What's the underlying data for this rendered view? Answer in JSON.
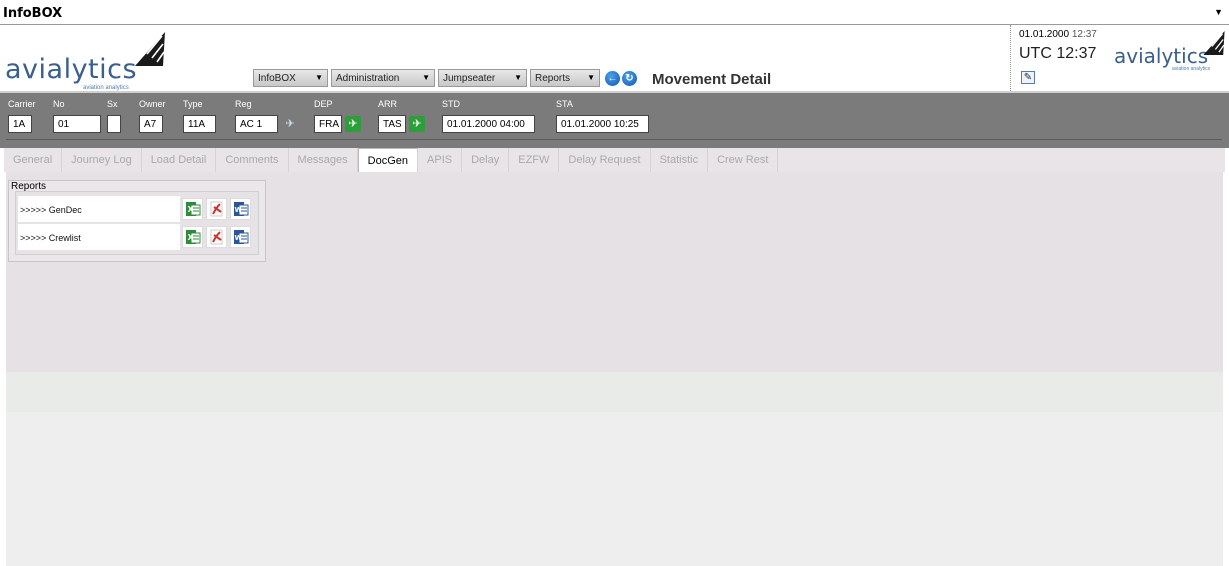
{
  "window": {
    "title": "InfoBOX"
  },
  "brand": {
    "name": "avialytics",
    "tagline": "aviation analytics"
  },
  "nav": {
    "menus": [
      "InfoBOX",
      "Administration",
      "Jumpseater",
      "Reports"
    ],
    "page_title": "Movement Detail"
  },
  "clock": {
    "date": "01.01.2000",
    "time": "12:37",
    "utc": "UTC 12:37"
  },
  "flight": {
    "labels": {
      "carrier": "Carrier",
      "no": "No",
      "sx": "Sx",
      "owner": "Owner",
      "type": "Type",
      "reg": "Reg",
      "dep": "DEP",
      "arr": "ARR",
      "std": "STD",
      "sta": "STA"
    },
    "values": {
      "carrier": "1A",
      "no": "01",
      "sx": "",
      "owner": "A7",
      "type": "11A",
      "reg": "AC 1",
      "dep": "FRA",
      "arr": "TAS",
      "std": "01.01.2000 04:00",
      "sta": "01.01.2000 10:25"
    }
  },
  "tabs": [
    "General",
    "Journey Log",
    "Load Detail",
    "Comments",
    "Messages",
    "DocGen",
    "APIS",
    "Delay",
    "EZFW",
    "Delay Request",
    "Statistic",
    "Crew Rest"
  ],
  "active_tab": "DocGen",
  "reports": {
    "title": "Reports",
    "rows": [
      {
        "name": ">>>>> GenDec"
      },
      {
        "name": ">>>>> Crewlist"
      }
    ]
  },
  "colors": {
    "brand": "#3a5f8a",
    "flightbar": "#7b7b7b",
    "tab_bg": "#e8e4e8",
    "excel": "#2e8b3a",
    "pdf": "#d2322d",
    "word": "#2b579a"
  }
}
